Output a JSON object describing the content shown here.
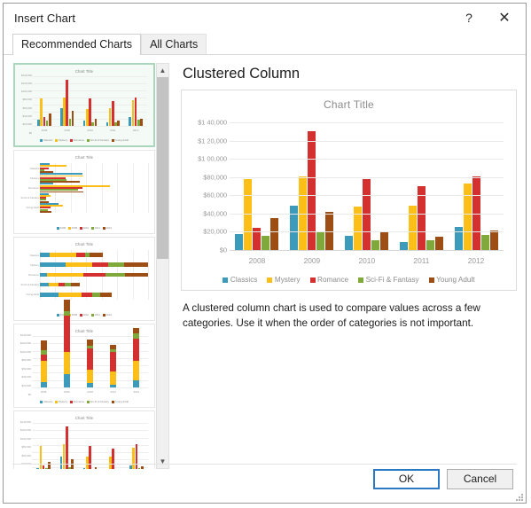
{
  "window": {
    "title": "Insert Chart",
    "help_icon": "question-mark-icon",
    "close_icon": "close-icon"
  },
  "tabs": [
    {
      "label": "Recommended Charts",
      "active": true
    },
    {
      "label": "All Charts",
      "active": false
    }
  ],
  "gallery": {
    "scroll_up_icon": "chevron-up-icon",
    "scroll_down_icon": "chevron-down-icon",
    "thumbnails": [
      {
        "name": "clustered-column",
        "title": "Chart Title",
        "selected": true
      },
      {
        "name": "clustered-bar",
        "title": "Chart Title",
        "selected": false
      },
      {
        "name": "stacked-bar",
        "title": "Chart Title",
        "selected": false
      },
      {
        "name": "stacked-column",
        "title": "Chart Title",
        "selected": false
      },
      {
        "name": "clustered-column-alt",
        "title": "Chart Title",
        "selected": false
      }
    ]
  },
  "preview": {
    "heading": "Clustered Column",
    "description": "A clustered column chart is used to compare values across a few categories. Use it when the order of categories is not important."
  },
  "footer": {
    "ok_label": "OK",
    "cancel_label": "Cancel"
  },
  "colors": {
    "classics": "#3c9aba",
    "mystery": "#fcbf18",
    "romance": "#d3302f",
    "scifi": "#7fa93b",
    "young_adult": "#9c4e15",
    "selection_border": "#a9d6bd",
    "default_button_border": "#2b79c2"
  },
  "chart_data": {
    "type": "bar",
    "title": "Chart Title",
    "xlabel": "",
    "ylabel": "",
    "ylim": [
      0,
      140000
    ],
    "ytick_step": 20000,
    "grid": true,
    "legend_position": "bottom",
    "ytick_labels": [
      "$0",
      "$20,000",
      "$40,000",
      "$60,000",
      "$80,000",
      "$1 00,000",
      "$1 20,000",
      "$1 40,000"
    ],
    "categories": [
      "2008",
      "2009",
      "2010",
      "2011",
      "2012"
    ],
    "series": [
      {
        "name": "Classics",
        "color": "#3c9aba",
        "values": [
          18000,
          49000,
          16000,
          9000,
          25000
        ]
      },
      {
        "name": "Mystery",
        "color": "#fcbf18",
        "values": [
          78000,
          81000,
          48000,
          49000,
          73000
        ]
      },
      {
        "name": "Romance",
        "color": "#d3302f",
        "values": [
          24000,
          130000,
          78000,
          70000,
          81000
        ]
      },
      {
        "name": "Sci-Fi & Fantasy",
        "color": "#7fa93b",
        "values": [
          16000,
          19000,
          11000,
          11000,
          17000
        ]
      },
      {
        "name": "Young Adult",
        "color": "#9c4e15",
        "values": [
          35000,
          42000,
          20000,
          15000,
          21000
        ]
      }
    ]
  }
}
